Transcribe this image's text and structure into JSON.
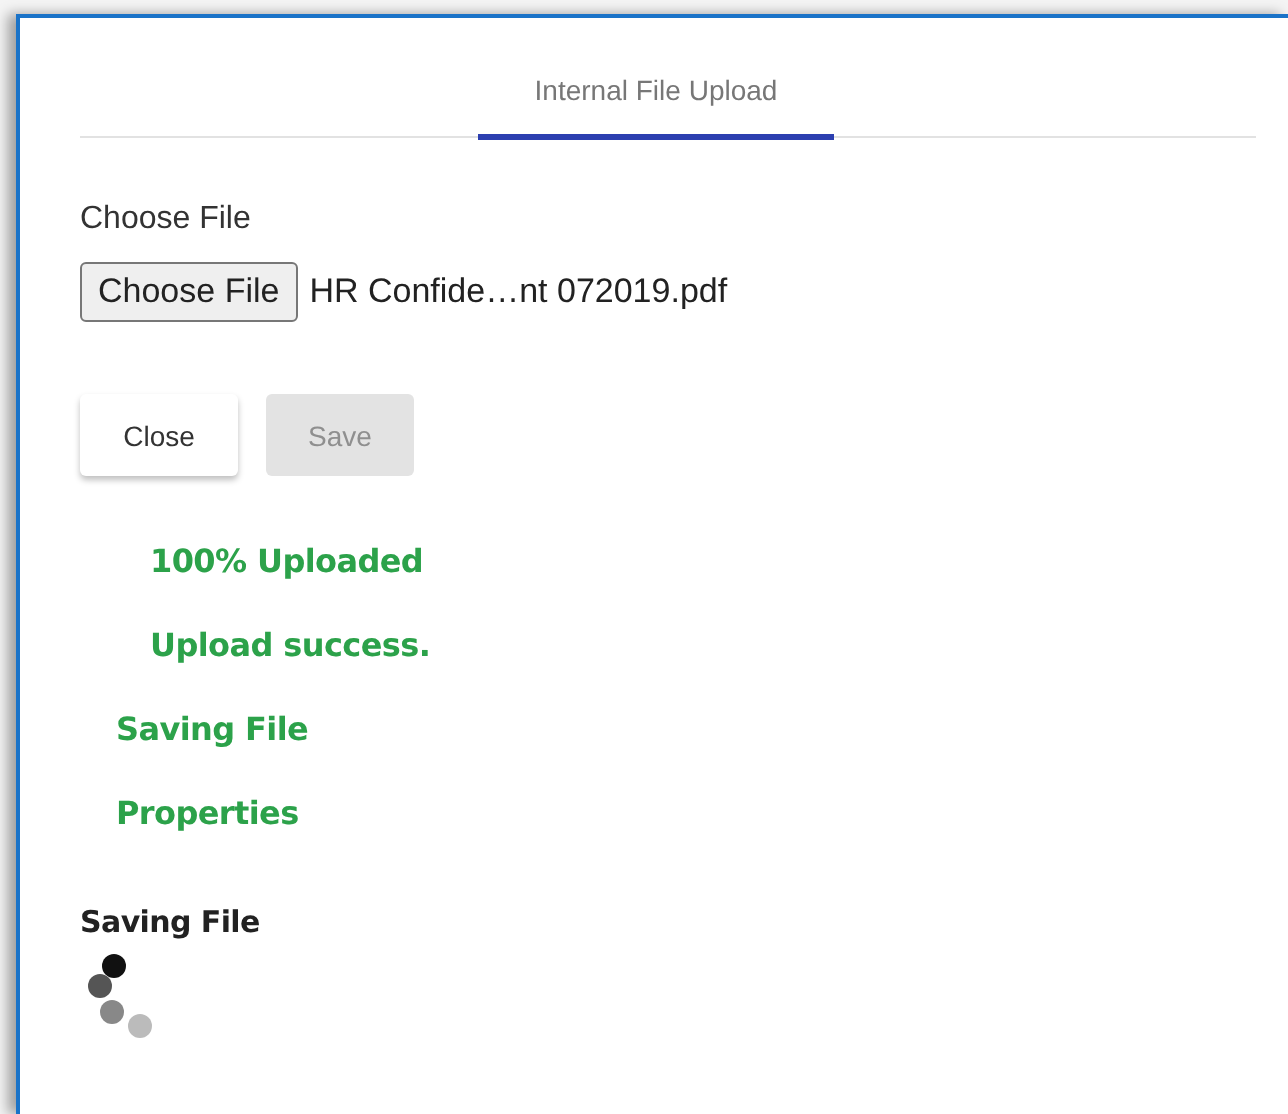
{
  "tabs": [
    {
      "label": "Internal File Upload",
      "selected": true
    }
  ],
  "file_field": {
    "label": "Choose File",
    "button": "Choose File",
    "value": "HR Confide…nt 072019.pdf"
  },
  "buttons": [
    {
      "label": "Close",
      "disabled": false
    },
    {
      "label": "Save",
      "disabled": true
    }
  ],
  "messages": [
    {
      "text": "100% Uploaded",
      "indented": true
    },
    {
      "text": "Upload success.",
      "indented": true
    },
    {
      "text": "Saving File",
      "indented": false
    },
    {
      "text": "Properties",
      "indented": false
    }
  ],
  "progress": {
    "title": "Saving File"
  }
}
